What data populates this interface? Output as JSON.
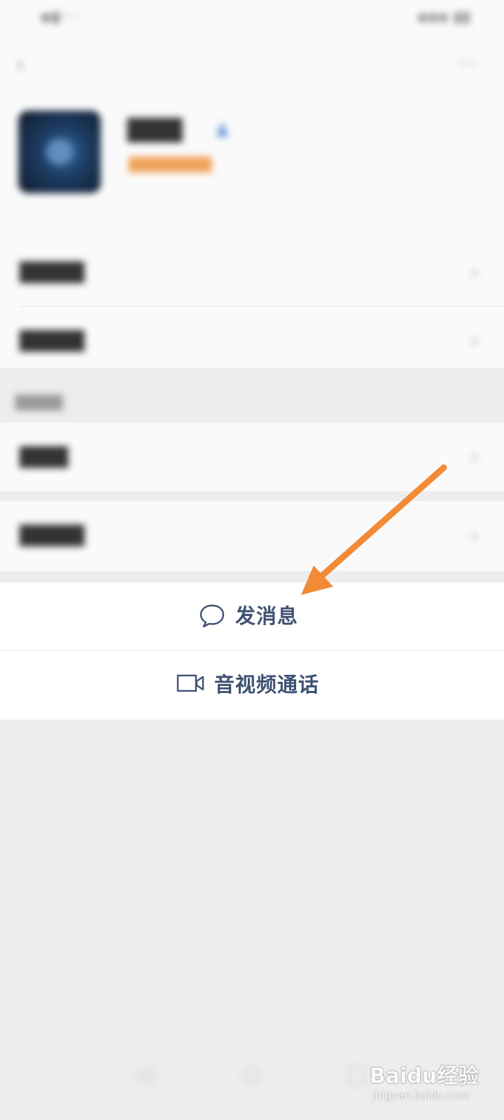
{
  "status_bar": {
    "left_text": "",
    "right_text": ""
  },
  "icons": {
    "back": "back-arrow-icon",
    "more": "more-dots-icon",
    "chat": "chat-bubble-icon",
    "video": "video-camera-icon"
  },
  "actions": {
    "send_message": "发消息",
    "av_call": "音视频通话"
  },
  "watermark": {
    "logo_text": "Baidu经验",
    "url": "jingyan.baidu.com"
  },
  "colors": {
    "action_text": "#3f5272",
    "annotation_arrow": "#f28a36",
    "page_background": "#ededed"
  }
}
